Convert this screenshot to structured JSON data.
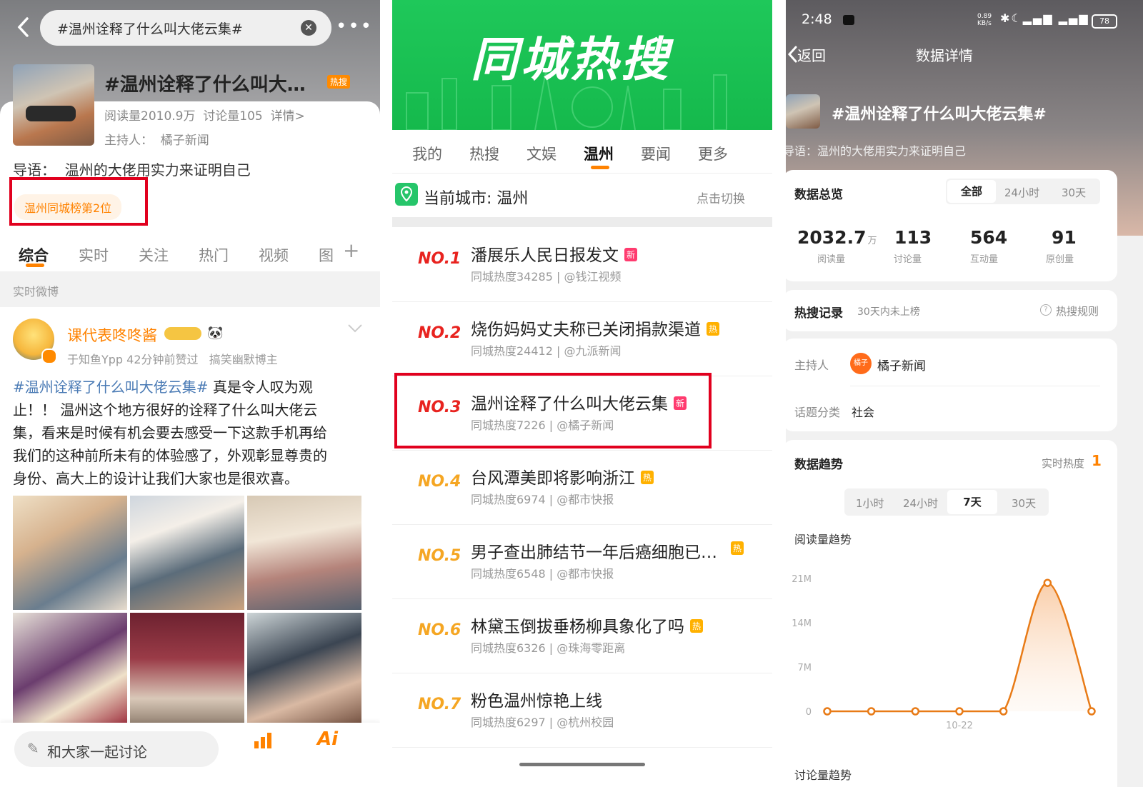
{
  "left": {
    "search_text": "#温州诠释了什么叫大佬云集#",
    "topic_title": "#温州诠释了什么叫大佬…",
    "hot_badge": "热搜",
    "stats": "阅读量2010.9万  讨论量105  详情>",
    "host": "主持人：  橘子新闻",
    "intro": "导语：  温州的大佬用实力来证明自己",
    "rank_chip": "温州同城榜第2位",
    "tabs": [
      "综合",
      "实时",
      "关注",
      "热门",
      "视频",
      "图"
    ],
    "section": "实时微博",
    "post": {
      "user": "课代表咚咚酱",
      "meta": "于知鱼Ypp 42分钟前赞过   搞笑幽默博主",
      "hashtag": "#温州诠释了什么叫大佬云集#",
      "lines": [
        "真是令人叹为观",
        "止！！ 温州这个地方很好的诠释了什么叫大佬云",
        "集，看来是时候有机会要去感受一下这款手机再给",
        "我们的这种前所未有的体验感了，外观彰显尊贵的",
        "身份、高大上的设计让我们大家也是很欢喜。"
      ]
    },
    "comment_placeholder": "和大家一起讨论"
  },
  "middle": {
    "banner_title": "同城热搜",
    "tabs": [
      "我的",
      "热搜",
      "文娱",
      "温州",
      "要闻",
      "更多"
    ],
    "city_label": "当前城市: 温州",
    "switch_label": "点击切换",
    "items": [
      {
        "rank": "NO.1",
        "title": "潘展乐人民日报发文",
        "badge": "新",
        "sub": "同城热度34285 | @钱江视频"
      },
      {
        "rank": "NO.2",
        "title": "烧伤妈妈丈夫称已关闭捐款渠道",
        "badge": "热",
        "sub": "同城热度24412 | @九派新闻"
      },
      {
        "rank": "NO.3",
        "title": "温州诠释了什么叫大佬云集",
        "badge": "新",
        "sub": "同城热度7226 | @橘子新闻"
      },
      {
        "rank": "NO.4",
        "title": "台风潭美即将影响浙江",
        "badge": "热",
        "sub": "同城热度6974 | @都市快报"
      },
      {
        "rank": "NO.5",
        "title": "男子查出肺结节一年后癌细胞已…",
        "badge": "热",
        "sub": "同城热度6548 | @都市快报"
      },
      {
        "rank": "NO.6",
        "title": "林黛玉倒拔垂杨柳具象化了吗",
        "badge": "热",
        "sub": "同城热度6326 | @珠海零距离"
      },
      {
        "rank": "NO.7",
        "title": "粉色温州惊艳上线",
        "badge": "",
        "sub": "同城热度6297 | @杭州校园"
      }
    ]
  },
  "right": {
    "time": "2:48",
    "status_speed": "0.89 KB/s",
    "battery": "78",
    "back_label": "返回",
    "page_title": "数据详情",
    "topic": "#温州诠释了什么叫大佬云集#",
    "intro": "导语：温州的大佬用实力来证明自己",
    "overview": {
      "title": "数据总览",
      "ranges": [
        "全部",
        "24小时",
        "30天"
      ],
      "stats": [
        {
          "value": "2032.7",
          "unit": "万",
          "label": "阅读量"
        },
        {
          "value": "113",
          "unit": "",
          "label": "讨论量"
        },
        {
          "value": "564",
          "unit": "",
          "label": "互动量"
        },
        {
          "value": "91",
          "unit": "",
          "label": "原创量"
        }
      ]
    },
    "hot_record": {
      "title": "热搜记录",
      "note": "30天内未上榜",
      "rules": "热搜规则"
    },
    "info": {
      "host_label": "主持人",
      "host_avatar_text": "橘子",
      "host_value": "橘子新闻",
      "category_label": "话题分类",
      "category_value": "社会"
    },
    "trend": {
      "title": "数据趋势",
      "realtime_label": "实时热度",
      "realtime_value": "1",
      "ranges": [
        "1小时",
        "24小时",
        "7天",
        "30天"
      ],
      "chart_title": "阅读量趋势",
      "next_label": "讨论量趋势"
    }
  },
  "chart_data": {
    "type": "line",
    "title": "阅读量趋势",
    "y_ticks": [
      "21M",
      "14M",
      "7M",
      "0"
    ],
    "ylim": [
      0,
      21
    ],
    "x_label_shown": "10-22",
    "x": [
      "",
      "",
      "",
      "10-22",
      "",
      "",
      ""
    ],
    "values": [
      0,
      0,
      0,
      0,
      0,
      20.3,
      0
    ],
    "color": "#e87b17"
  }
}
